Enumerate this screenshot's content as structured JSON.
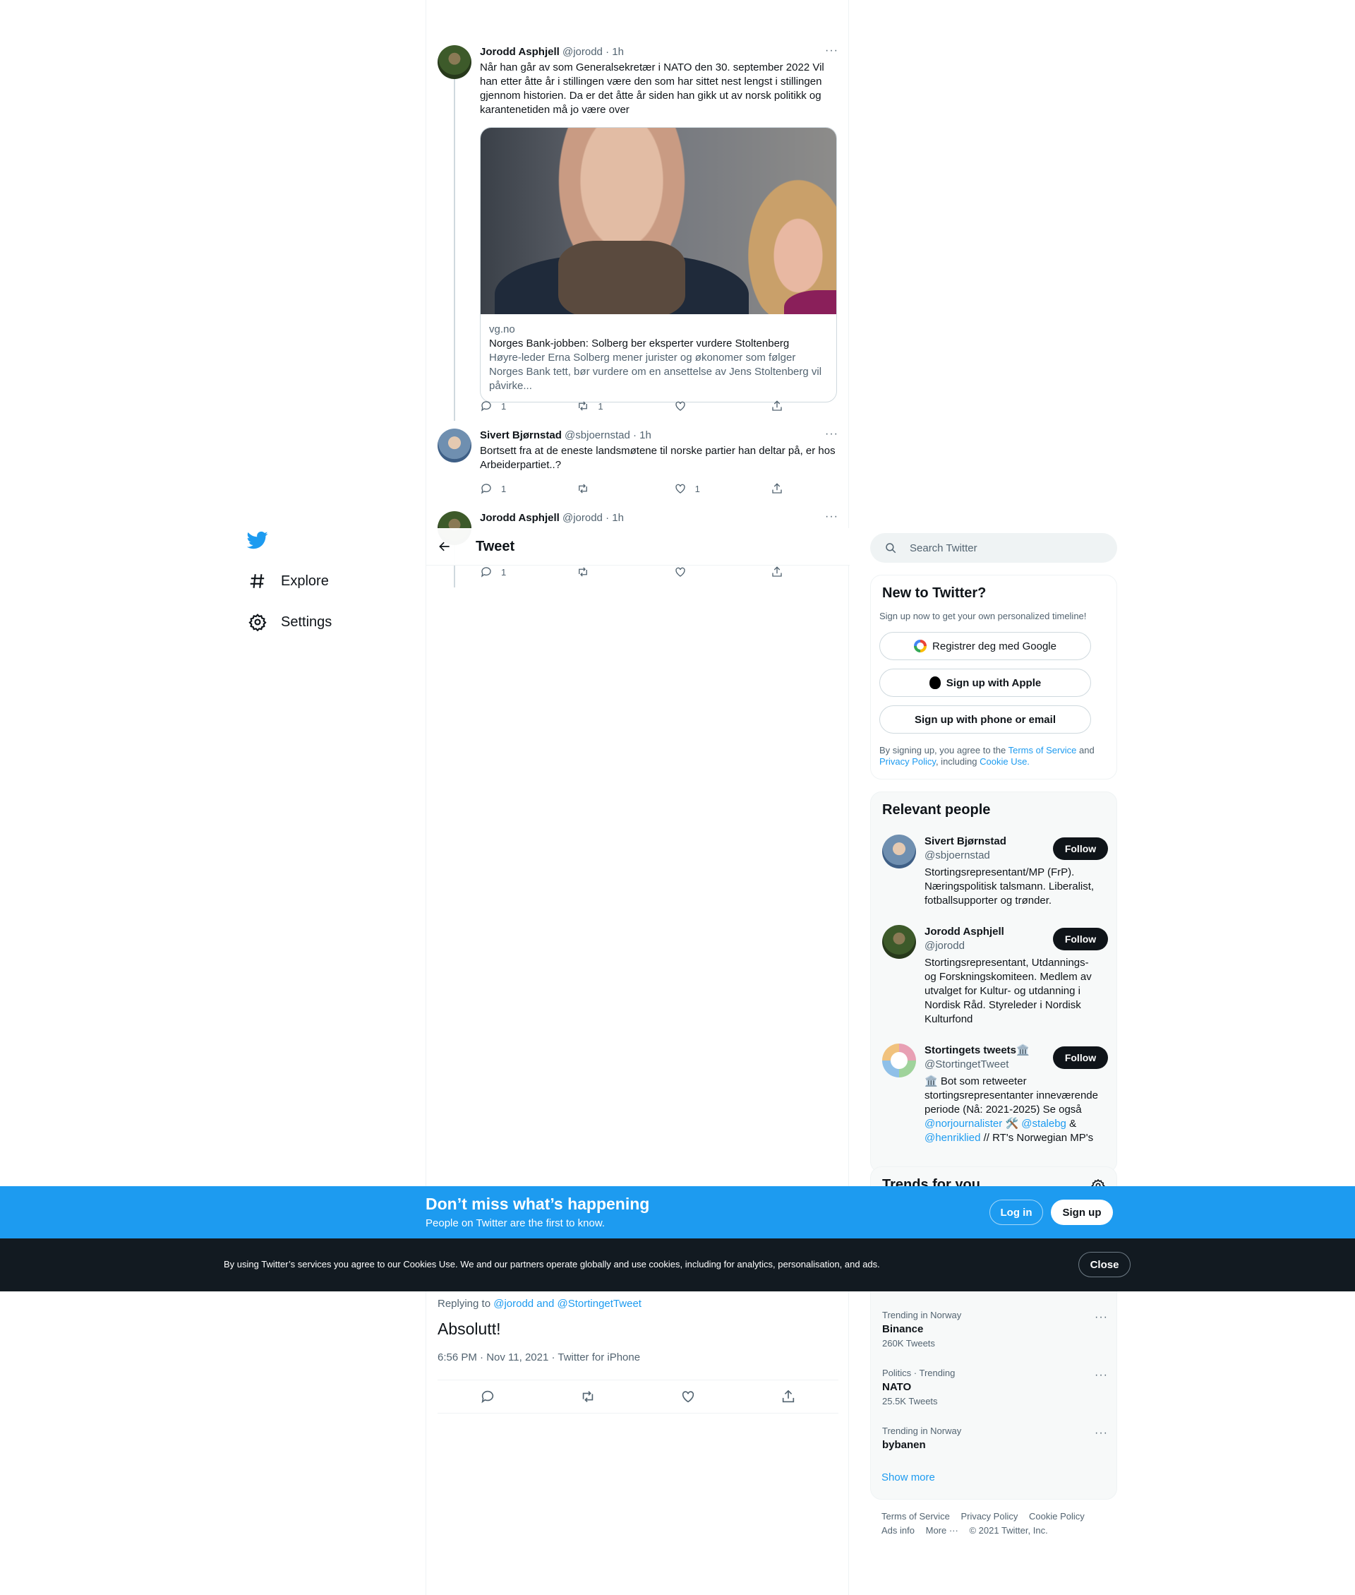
{
  "nav": {
    "explore": "Explore",
    "settings": "Settings"
  },
  "header": {
    "title": "Tweet"
  },
  "thread": [
    {
      "name": "Jorodd Asphjell",
      "handle": "@jorodd",
      "time": "1h",
      "text": "Når han går av som Generalsekretær i NATO den 30. september 2022 Vil han etter åtte år i stillingen være den som har sittet nest lengst i stillingen gjennom historien. Da er det åtte år siden han gikk ut av norsk politikk og karantenetiden må jo være over",
      "card": {
        "domain": "vg.no",
        "title": "Norges Bank-jobben: Solberg ber eksperter vurdere Stoltenberg",
        "desc": "Høyre-leder Erna Solberg mener jurister og økonomer som følger Norges Bank tett, bør vurdere om en ansettelse av Jens Stoltenberg vil påvirke..."
      },
      "replies": "1",
      "retweets": "1",
      "likes": ""
    },
    {
      "name": "Sivert Bjørnstad",
      "handle": "@sbjoernstad",
      "time": "1h",
      "text": "Bortsett fra at de eneste landsmøtene til norske partier han deltar på, er hos Arbeiderpartiet..?",
      "replies": "1",
      "retweets": "",
      "likes": "1"
    },
    {
      "name": "Jorodd Asphjell",
      "handle": "@jorodd",
      "time": "1h",
      "replies": "1",
      "retweets": "",
      "likes": ""
    }
  ],
  "focus": {
    "replying_prefix": "Replying to ",
    "replying_to": "@jorodd and @StortingetTweet",
    "text": "Absolutt!",
    "timestamp": "6:56 PM · Nov 11, 2021 · Twitter for iPhone"
  },
  "search": {
    "placeholder": "Search Twitter"
  },
  "signup": {
    "title": "New to Twitter?",
    "subtitle": "Sign up now to get your own personalized timeline!",
    "google": "Registrer deg med Google",
    "apple": "Sign up with Apple",
    "email": "Sign up with phone or email",
    "terms_pre": "By signing up, you agree to the ",
    "terms_link": "Terms of Service",
    "terms_and": " and ",
    "privacy_link": "Privacy Policy",
    "terms_incl": ", including ",
    "cookie_link": "Cookie Use."
  },
  "people": {
    "title": "Relevant people",
    "follow_label": "Follow",
    "items": [
      {
        "name": "Sivert Bjørnstad",
        "handle": "@sbjoernstad",
        "bio": "Stortingsrepresentant/MP (FrP). Næringspolitisk talsmann. Liberalist, fotballsupporter og trønder."
      },
      {
        "name": "Jorodd Asphjell",
        "handle": "@jorodd",
        "bio": "Stortingsrepresentant, Utdannings- og Forskningskomiteen. Medlem av utvalget for Kultur- og utdanning i Nordisk Råd. Styreleder i Nordisk Kulturfond"
      },
      {
        "name": "Stortingets tweets🏛️",
        "handle": "@StortingetTweet",
        "bio_pre": "🏛️ Bot som retweeter stortingsrepresentanter inneværende periode (Nå: 2021-2025) Se også ",
        "link1": "@norjournalister",
        "mid1": " 🛠️ ",
        "link2": "@stalebg",
        "mid2": " & ",
        "link3": "@henriklied",
        "bio_post": " // RT's Norwegian MP's"
      }
    ]
  },
  "trends": {
    "title": "Trends for you",
    "items": [
      {
        "context": "Trending in Norway",
        "name": "Binance",
        "count": "260K Tweets"
      },
      {
        "context": "Politics · Trending",
        "name": "NATO",
        "count": "25.5K Tweets"
      },
      {
        "context": "Trending in Norway",
        "name": "bybanen",
        "count": ""
      }
    ],
    "show_more": "Show more"
  },
  "footer": {
    "tos": "Terms of Service",
    "privacy": "Privacy Policy",
    "cookie": "Cookie Policy",
    "ads": "Ads info",
    "more": "More ···",
    "copyright": "© 2021 Twitter, Inc."
  },
  "bottom_bar": {
    "title": "Don’t miss what’s happening",
    "subtitle": "People on Twitter are the first to know.",
    "login": "Log in",
    "signup": "Sign up"
  },
  "cookie_banner": {
    "text": "By using Twitter’s services you agree to our Cookies Use. We and our partners operate globally and use cookies, including for analytics, personalisation, and ads.",
    "close": "Close"
  },
  "colors": {
    "accent": "#1d9bf0",
    "text": "#0f1419",
    "muted": "#536471",
    "cookie_bg": "#121a21"
  }
}
